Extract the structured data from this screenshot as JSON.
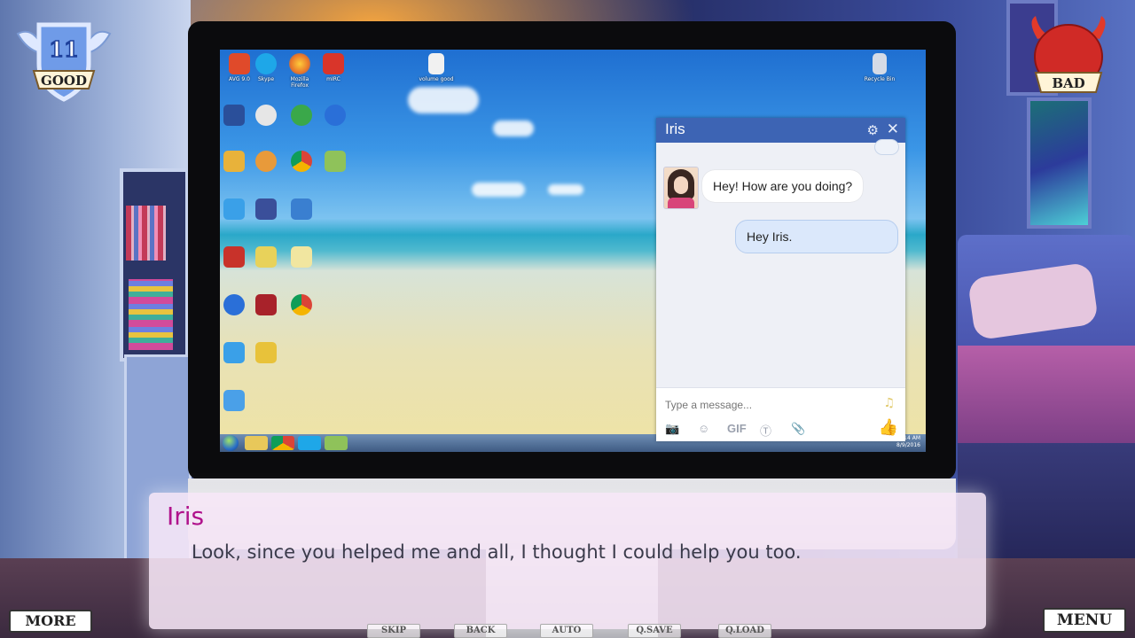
{
  "hud": {
    "good_score": "11",
    "good_label": "GOOD",
    "bad_label": "BAD",
    "more_label": "MORE",
    "menu_label": "MENU",
    "quick_menu": [
      "SKIP",
      "BACK",
      "AUTO",
      "Q.SAVE",
      "Q.LOAD"
    ]
  },
  "desktop": {
    "icons": [
      {
        "label": "AVG 9.0",
        "icon": "avg-icon",
        "color": "#e04a2a"
      },
      {
        "label": "Skype",
        "icon": "skype-icon",
        "color": "#1ea7e8"
      },
      {
        "label": "Mozilla Firefox",
        "icon": "firefox-icon",
        "color": "#e8762a"
      },
      {
        "label": "mIRC",
        "icon": "mirc-icon",
        "color": "#d9352a"
      },
      {
        "label": "volume good",
        "icon": "file-icon",
        "color": "#f1f1f1"
      },
      {
        "label": "Recycle Bin",
        "icon": "recycle-bin-icon",
        "color": "#d5dbe6"
      }
    ],
    "taskbar_time": "4:14 AM",
    "taskbar_date": "8/9/2016"
  },
  "chat": {
    "contact_name": "Iris",
    "messages": [
      {
        "from": "Iris",
        "text": "Hey! How are you doing?"
      },
      {
        "from": "me",
        "text": "Hey Iris."
      }
    ],
    "input_placeholder": "Type a message...",
    "gif_label": "GIF"
  },
  "dialogue": {
    "speaker": "Iris",
    "text": "Look, since you helped me and all, I thought I could help you too."
  },
  "colors": {
    "chat_header": "#3d64b4",
    "speaker_name": "#b0128c"
  }
}
